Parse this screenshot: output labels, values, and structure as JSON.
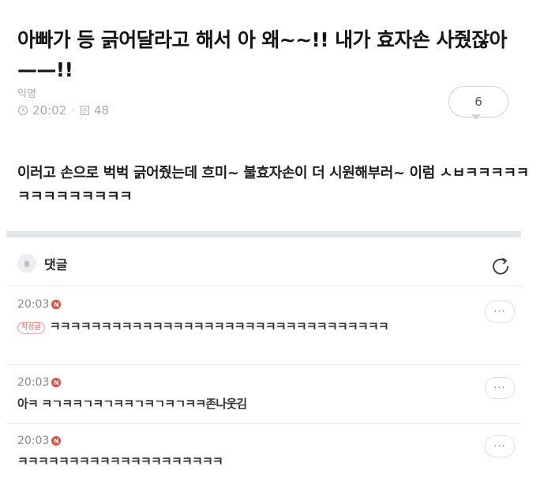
{
  "post": {
    "title": "아빠가 등 긁어달라고 해서 아 왜~~!! 내가 효자손 사줬잖아 ——!!",
    "author": "익명",
    "time": "20:02",
    "views": "48",
    "comment_count": "6",
    "body": "이러고 손으로 벅벅 긁어줬는데 흐미~ 불효자손이 더 시원해부러~ 이럼 ㅅㅂㅋㅋㅋㅋㅋㅋㅋㅋㅋㅋㅋㅋㅋㅋ"
  },
  "comments_section": {
    "label": "댓글"
  },
  "comments": [
    {
      "time": "20:03",
      "badge": "N",
      "tag": "작성글",
      "text": "ㅋㅋㅋㅋㅋㅋㅋㅋㅋㅋㅋㅋㅋㅋㅋㅋㅋㅋㅋㅋㅋㅋㅋㅋㅋㅋㅋㅋㅋㅋㅋㅋㅋ",
      "more": "···"
    },
    {
      "time": "20:03",
      "badge": "N",
      "text": "아ㅋ ㅋㄱㅋㅋㄱㅋㄱㅋㅋㄱㅋㄱㅋㄱㅋㅋ존나웃김",
      "more": "···"
    },
    {
      "time": "20:03",
      "badge": "N",
      "text": "ㅋㅋㅋㅋㅋㅋㅋㅋㅋㅋㅋㅋㅋㅋㅋㅋㅋㅋㅋㅋ",
      "more": "···"
    }
  ],
  "colors": {
    "badge": "#e04d43",
    "divider": "#e4e6ea",
    "meta": "#a9a9a9"
  },
  "icons": {
    "clock": "clock-icon",
    "views": "document-icon",
    "bell": "bell-icon",
    "refresh": "refresh-icon",
    "more": "more-icon"
  }
}
